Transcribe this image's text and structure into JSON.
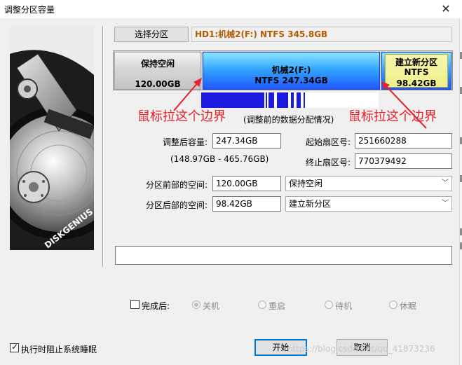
{
  "window": {
    "title": "调整分区容量",
    "close_glyph": "✕"
  },
  "art": {
    "brand": "DISKGENIUS"
  },
  "select_partition_label": "选择分区",
  "disk_info": "HD1:机械2(F:) NTFS 345.8GB",
  "partitions": [
    {
      "name": "保持空闲",
      "size": "120.00GB"
    },
    {
      "name": "机械2(F:)",
      "fs_size": "NTFS 247.34GB"
    },
    {
      "name": "建立新分区",
      "fs": "NTFS",
      "size": "98.42GB"
    }
  ],
  "annotations": {
    "left": "鼠标拉这个边界",
    "right": "鼠标拉这个边界"
  },
  "note": "(调整前的数据分配情况)",
  "form": {
    "adjusted_size_label": "调整后容量:",
    "adjusted_size_value": "247.34GB",
    "range": "(148.97GB - 465.76GB)",
    "start_sector_label": "起始扇区号:",
    "start_sector_value": "251660288",
    "end_sector_label": "终止扇区号:",
    "end_sector_value": "770379492",
    "before_space_label": "分区前部的空间:",
    "before_space_value": "120.00GB",
    "before_space_option": "保持空闲",
    "after_space_label": "分区后部的空间:",
    "after_space_value": "98.42GB",
    "after_space_option": "建立新分区"
  },
  "after_completion": {
    "label": "完成后:",
    "options": [
      "关机",
      "重启",
      "待机",
      "休眠"
    ]
  },
  "prevent_sleep_label": "执行时阻止系统睡眠",
  "buttons": {
    "start": "开始",
    "cancel": "取消"
  },
  "watermark": "https://blog.csdn.net/qq_41873236",
  "colors": {
    "annotation_red": "#e8202a",
    "partition_blue": "#2f8cff",
    "disk_label": "#b35a00"
  }
}
